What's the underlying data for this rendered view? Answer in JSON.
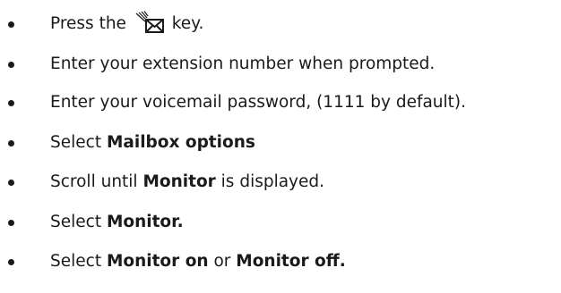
{
  "bullet_color": "#1a1a1a",
  "steps": [
    {
      "segments": [
        {
          "text": "Press the ",
          "bold": false
        },
        {
          "icon": "message-waiting-envelope-icon"
        },
        {
          "text": " key.",
          "bold": false
        }
      ]
    },
    {
      "segments": [
        {
          "text": "Enter your extension number when prompted.",
          "bold": false
        }
      ]
    },
    {
      "segments": [
        {
          "text": "Enter your voicemail password, (1111 by default).",
          "bold": false
        }
      ]
    },
    {
      "segments": [
        {
          "text": "Select ",
          "bold": false
        },
        {
          "text": "Mailbox options",
          "bold": true
        }
      ]
    },
    {
      "segments": [
        {
          "text": "Scroll until ",
          "bold": false
        },
        {
          "text": "Monitor",
          "bold": true
        },
        {
          "text": " is displayed.",
          "bold": false
        }
      ]
    },
    {
      "segments": [
        {
          "text": "Select ",
          "bold": false
        },
        {
          "text": "Monitor.",
          "bold": true
        }
      ]
    },
    {
      "segments": [
        {
          "text": "Select ",
          "bold": false
        },
        {
          "text": "Monitor on",
          "bold": true
        },
        {
          "text": " or ",
          "bold": false
        },
        {
          "text": "Monitor off.",
          "bold": true
        }
      ]
    }
  ]
}
